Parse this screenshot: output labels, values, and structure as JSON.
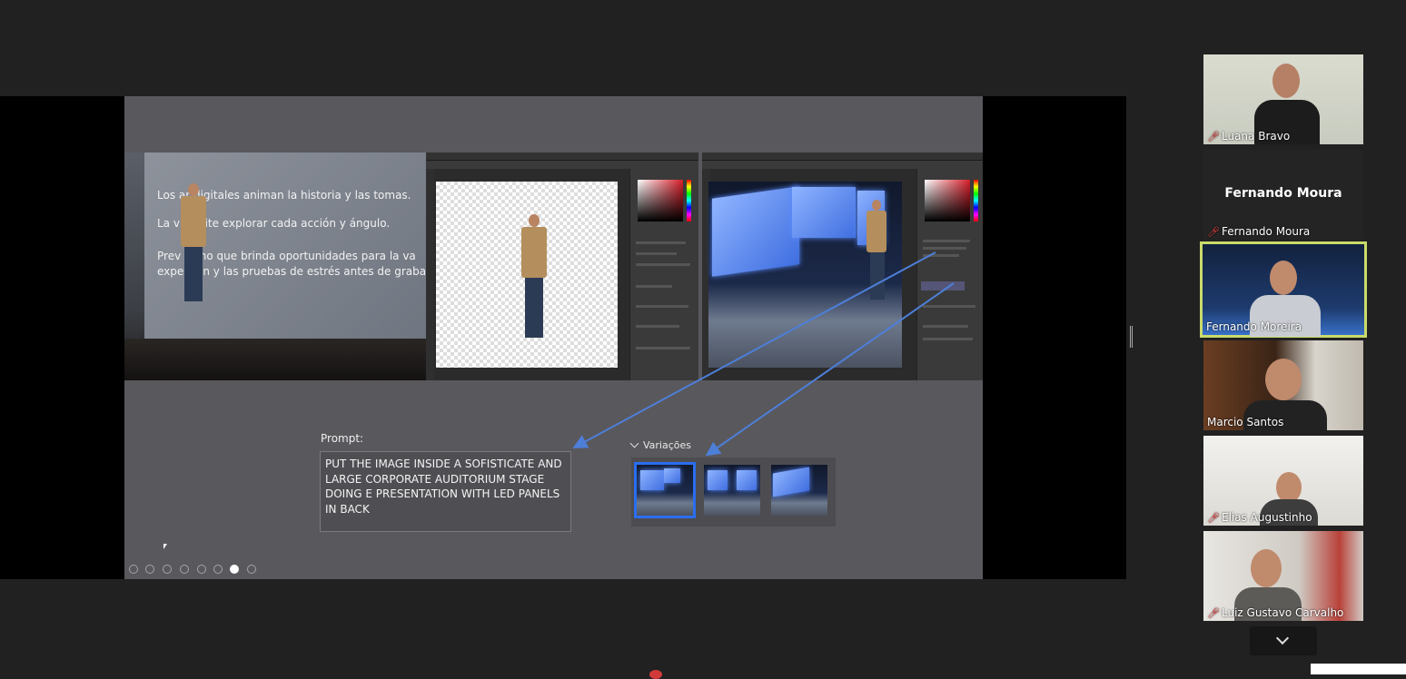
{
  "slide": {
    "stage_text": [
      "Los ar      digitales animan la historia y las tomas.",
      "La v       ermite explorar cada acción y ángulo.",
      "Prev       torno que brinda oportunidades para la va",
      "expe        ción y las pruebas de estrés antes de grabar."
    ],
    "prompt_label": "Prompt:",
    "prompt_text": "PUT THE IMAGE INSIDE A SOFISTICATE AND LARGE CORPORATE AUDITORIUM STAGE DOING E PRESENTATION WITH LED PANELS IN BACK",
    "variations_label": "Variações",
    "variations_selected_index": 0
  },
  "participants": [
    {
      "name": "Luana Bravo",
      "muted": true,
      "video": true
    },
    {
      "name": "Fernando Moura",
      "muted": true,
      "video": false,
      "placeholder_name": "Fernando Moura"
    },
    {
      "name": "Fernando Moreira",
      "muted": false,
      "video": true,
      "active_speaker": true
    },
    {
      "name": "Marcio Santos",
      "muted": false,
      "video": true
    },
    {
      "name": "Elias Augustinho",
      "muted": true,
      "video": true
    },
    {
      "name": "Luiz Gustavo Carvalho",
      "muted": true,
      "video": true
    }
  ],
  "icons": {
    "mute": "mic-off-icon",
    "scroll": "chevron-down-icon"
  },
  "colors": {
    "accent_blue": "#2a6ef0",
    "speaker_outline": "#c9db6b",
    "mute_red": "#e34040"
  }
}
